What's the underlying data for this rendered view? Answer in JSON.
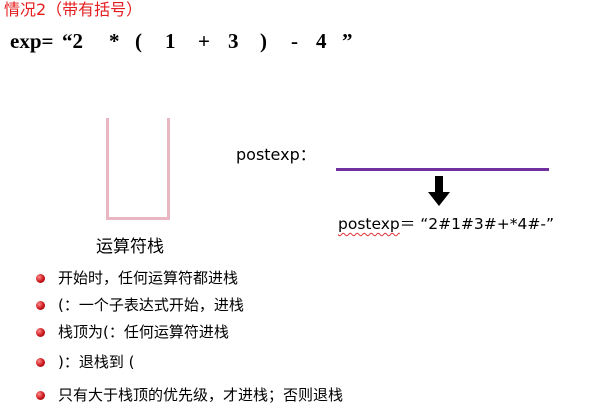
{
  "title": "情况2（带有括号）",
  "expression": {
    "label": "exp=",
    "tokens": [
      "“2",
      "*",
      "(",
      "1",
      "+",
      "3",
      ")",
      "-",
      "4",
      "”"
    ]
  },
  "stack": {
    "label": "运算符栈"
  },
  "postexp": {
    "label": "postexp：",
    "result_word": "postexp",
    "result_rest": "＝ “2#1#3#+*4#-”"
  },
  "bullets": [
    "开始时，任何运算符都进栈",
    "(：一个子表达式开始，进栈",
    "栈顶为(：任何运算符进栈",
    ")：退栈到 (",
    "只有大于栈顶的优先级，才进栈；否则退栈"
  ],
  "colors": {
    "title": "#e41e1e",
    "stack_border": "#e9b7c1",
    "postexp_line": "#7030a0",
    "bullet": "#c9161b"
  },
  "icons": {
    "arrow": "down-arrow-icon",
    "bullet": "bullet-dot-icon"
  }
}
